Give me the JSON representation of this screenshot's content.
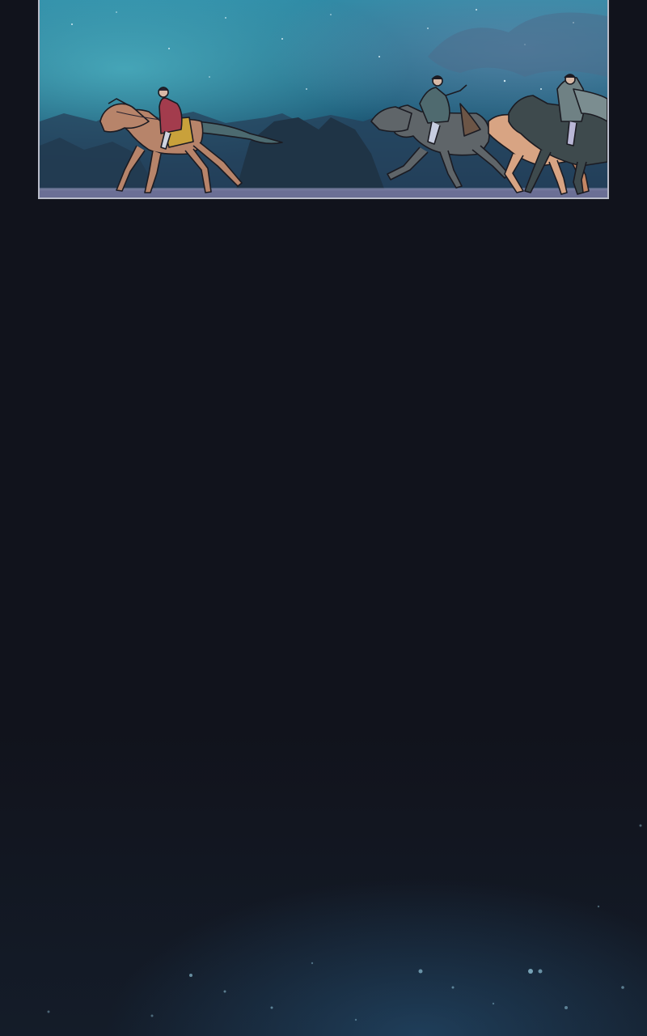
{
  "panel": {
    "scene": "riders-on-horseback-night",
    "sky_colors": [
      "#3fa3b7",
      "#215b74",
      "#1a3350"
    ],
    "riders": [
      {
        "role": "lead-rider",
        "horse_color": "#b7846a",
        "cloak_color": "#a33c4d"
      },
      {
        "role": "rider-2",
        "horse_color": "#5f6569",
        "cloak_color": "#4f6a6f"
      },
      {
        "role": "rider-3",
        "horse_color": "#d8a483",
        "cloak_color": "#6b7c86"
      },
      {
        "role": "rider-4",
        "horse_color": "#3e4a4d",
        "cloak_color": "#6f8184"
      }
    ]
  },
  "background": {
    "base_color": "#11131c",
    "glow_color": "#28507a"
  }
}
